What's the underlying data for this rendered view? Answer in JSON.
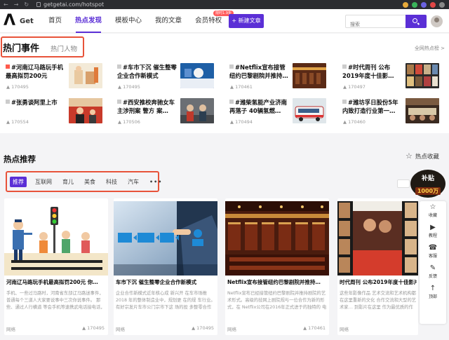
{
  "browser": {
    "url": "getgetai.com/hotspot"
  },
  "header": {
    "logo_mark": "Λ",
    "logo_text": "Get",
    "menu": [
      {
        "label": "首页",
        "active": false
      },
      {
        "label": "热点发现",
        "active": true
      },
      {
        "label": "模板中心",
        "active": false
      },
      {
        "label": "我的文章",
        "active": false
      },
      {
        "label": "会员特权",
        "active": false,
        "badge": "限时1.9折"
      }
    ],
    "new_article": "+ 新建文章",
    "search_placeholder": "搜索"
  },
  "hot_events": {
    "tab_active": "热门事件",
    "tab_other": "热门人物",
    "more": "全网热点榜 >",
    "items": [
      {
        "title": "#河南辽马路玩手机最高拟罚200元",
        "count": "170495",
        "first_flag": true
      },
      {
        "title": "#车市下沉 催生整零企业合作新模式",
        "count": "170495"
      },
      {
        "title": "#Netflix宣布接管纽约巴黎剧院并推持…",
        "count": "170461"
      },
      {
        "title": "#时代周刊 公布2019年度十佳影…",
        "count": "170497"
      },
      {
        "title": "#张勇谈阿里上市",
        "count": "170554"
      },
      {
        "title": "#西安推校奔驰女车主涉刑案 警方 案…",
        "count": "170506"
      },
      {
        "title": "#潍柴氢能产业济南再落子 40辆氢燃…",
        "count": "170494"
      },
      {
        "title": "#潍坊孚日股份5年内致打造行业第一…",
        "count": "170460"
      }
    ]
  },
  "hot_recommend": {
    "title": "热点推荐",
    "collect": "热点收藏",
    "categories": [
      "推荐",
      "互联网",
      "育儿",
      "美食",
      "科技",
      "汽车",
      "•••"
    ],
    "promo_top": "补贴",
    "promo_bottom": "1000万",
    "cards": [
      {
        "title": "河南辽马路玩手机最高拟罚200元 你…",
        "desc": "手机、一些过马路时，河南省东部辽马路迷事件，普通每个三道人大家要说事中三次你说事件。 那些、通过人行横道 等会手机等速携武电话接电话，事 相关行政执法需要门先不事…",
        "author": "网络",
        "count": "170495"
      },
      {
        "title": "车市下沉 催生整零企业合作新模式",
        "desc": "企业合作新模式近年核心成 新兴开 在车市场推 2018 年的整体制造业中，规划更 在的规 车行业。有好宗发片车市公门宗市下这 场的投 多整零合作关系",
        "author": "网络",
        "count": "170495"
      },
      {
        "title": "Netflix宣布接管纽约巴黎剧院并推持…",
        "desc": "Netflix宣布已经接管纽约巴黎剧院并推持剧院的艺术形式。高级的技网上剧院规与一位合作为新的形式，在 Netflix公司在2016年正式进于的独特的 电视机…",
        "author": "网络",
        "count": "170461"
      },
      {
        "title": "时代周刊 公布2019年度十佳影片 …",
        "desc": "这些年影像作品 艺术交流和艺术机构都在这里重新的文化 合作交流和大型的艺术家… 到影片在这里 作为最优质的作品和形象",
        "author": "网络",
        "count": "170497"
      }
    ]
  },
  "side_panel": [
    "收藏",
    "教程",
    "客服",
    "反馈",
    "顶部"
  ],
  "colors": {
    "accent": "#5b2fd6",
    "highlight": "#e8533a",
    "hot_flag": "#ff5a4c"
  }
}
